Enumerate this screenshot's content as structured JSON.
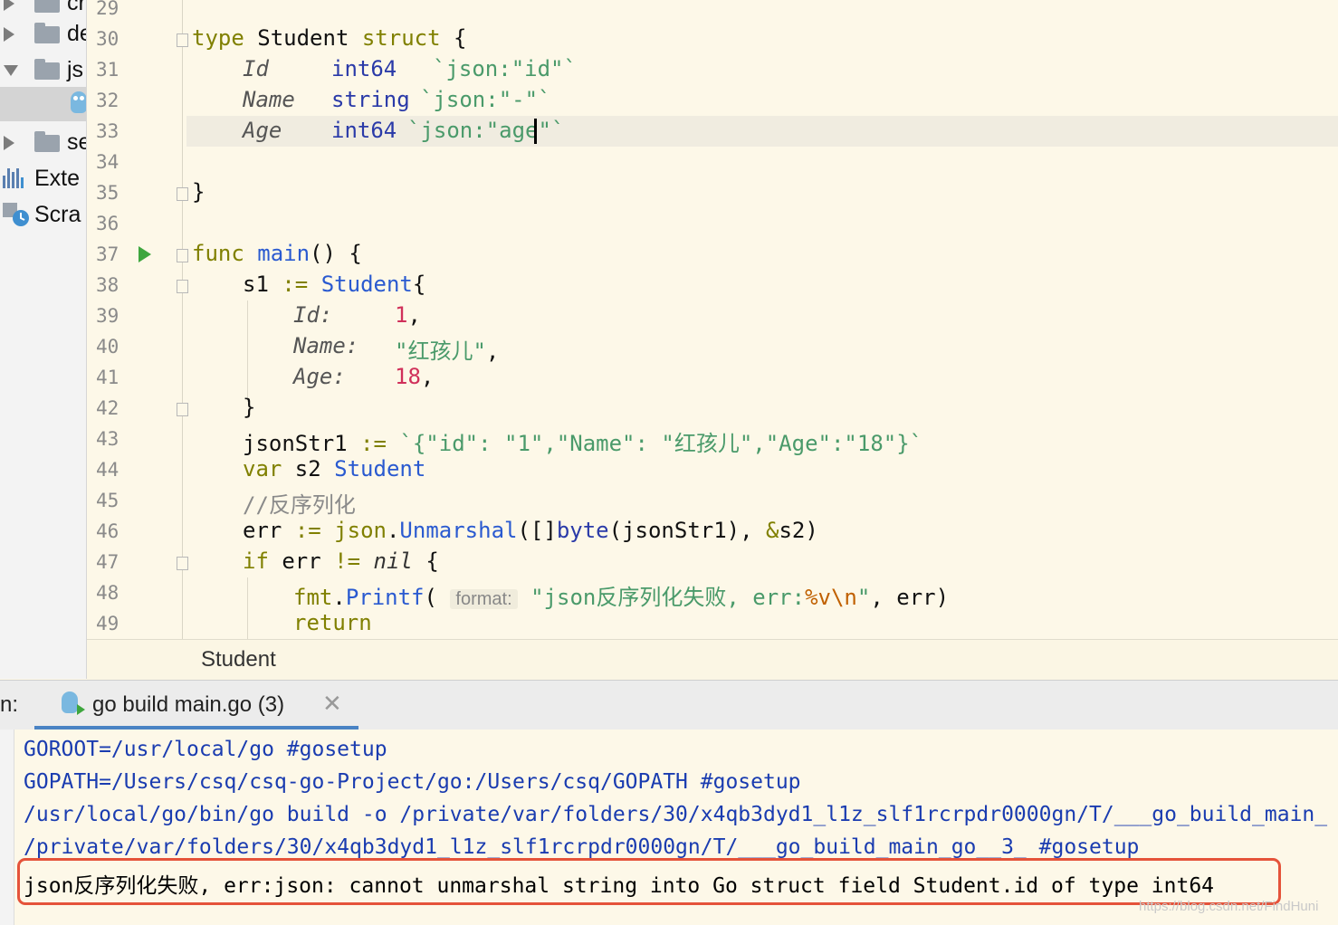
{
  "sidebar": {
    "items": [
      {
        "label": "cr",
        "type": "folder",
        "expanded": false
      },
      {
        "label": "de",
        "type": "folder",
        "expanded": false
      },
      {
        "label": "js",
        "type": "folder",
        "expanded": true
      },
      {
        "label": "",
        "type": "go-file",
        "selected": true
      },
      {
        "label": "se",
        "type": "folder",
        "expanded": false
      },
      {
        "label": "Exte",
        "type": "external-libraries"
      },
      {
        "label": "Scra",
        "type": "scratches"
      }
    ]
  },
  "editor": {
    "line_numbers": [
      "29",
      "30",
      "31",
      "32",
      "33",
      "34",
      "35",
      "36",
      "37",
      "38",
      "39",
      "40",
      "41",
      "42",
      "43",
      "44",
      "45",
      "46",
      "47",
      "48",
      "49"
    ],
    "code": {
      "l30": {
        "kw1": "type",
        "name": " Student ",
        "kw2": "struct",
        "rest": " {"
      },
      "l31": {
        "field": "Id",
        "type": "int64",
        "tag": "`json:\"id\"`"
      },
      "l32": {
        "field": "Name",
        "type": "string",
        "tag": "`json:\"-\"`"
      },
      "l33": {
        "field": "Age",
        "type": "int64",
        "tag_a": "`json:\"age",
        "tag_b": "\"`"
      },
      "l35": "}",
      "l37": {
        "kw": "func",
        "name": "main",
        "rest": "() {"
      },
      "l38": {
        "var": "s1",
        "op": ":=",
        "type": "Student",
        "rest": "{"
      },
      "l39": {
        "field": "Id:",
        "value": "1",
        "comma": ","
      },
      "l40": {
        "field": "Name:",
        "value": "\"红孩儿\"",
        "comma": ","
      },
      "l41": {
        "field": "Age:",
        "value": "18",
        "comma": ","
      },
      "l42": "}",
      "l43": {
        "var": "jsonStr1",
        "op": ":=",
        "str": "`{\"id\": \"1\",\"Name\": \"红孩儿\",\"Age\":\"18\"}`"
      },
      "l44": {
        "kw": "var",
        "name": " s2 ",
        "type": "Student"
      },
      "l45": "//反序列化",
      "l46": {
        "var": "err",
        "op": ":=",
        "pkg": "json",
        "fn": "Unmarshal",
        "open": "([]",
        "bt": "byte",
        "rest": "(jsonStr1), ",
        "amp": "&",
        "rest2": "s2)"
      },
      "l47": {
        "kw": "if",
        "rest": " err ",
        "op": "!=",
        "nil": "nil",
        "brace": " {"
      },
      "l48": {
        "pkg": "fmt",
        "fn": "Printf",
        "hint": "format:",
        "str1": "\"json反序列化失败, err:",
        "esc1": "%v",
        "esc2": "\\n",
        "str2": "\"",
        "rest": ", err)"
      },
      "l49": "return"
    }
  },
  "breadcrumb": {
    "label": "Student"
  },
  "run_panel": {
    "label": "n:",
    "tab_title": "go build main.go (3)",
    "close_glyph": "✕",
    "lines": [
      "GOROOT=/usr/local/go #gosetup",
      "GOPATH=/Users/csq/csq-go-Project/go:/Users/csq/GOPATH #gosetup",
      "/usr/local/go/bin/go build -o /private/var/folders/30/x4qb3dyd1_l1z_slf1rcrpdr0000gn/T/___go_build_main_",
      "/private/var/folders/30/x4qb3dyd1_l1z_slf1rcrpdr0000gn/T/___go_build_main_go__3_ #gosetup",
      "json反序列化失败, err:json: cannot unmarshal string into Go struct field Student.id of type int64"
    ],
    "watermark": "https://blog.csdn.net/FindHuni"
  },
  "colors": {
    "editor_bg": "#fdf8e8",
    "keyword": "#808000",
    "type": "#2a3aa8",
    "string": "#4a9a6a",
    "number": "#d0305a",
    "highlight_box": "#e5533a"
  }
}
